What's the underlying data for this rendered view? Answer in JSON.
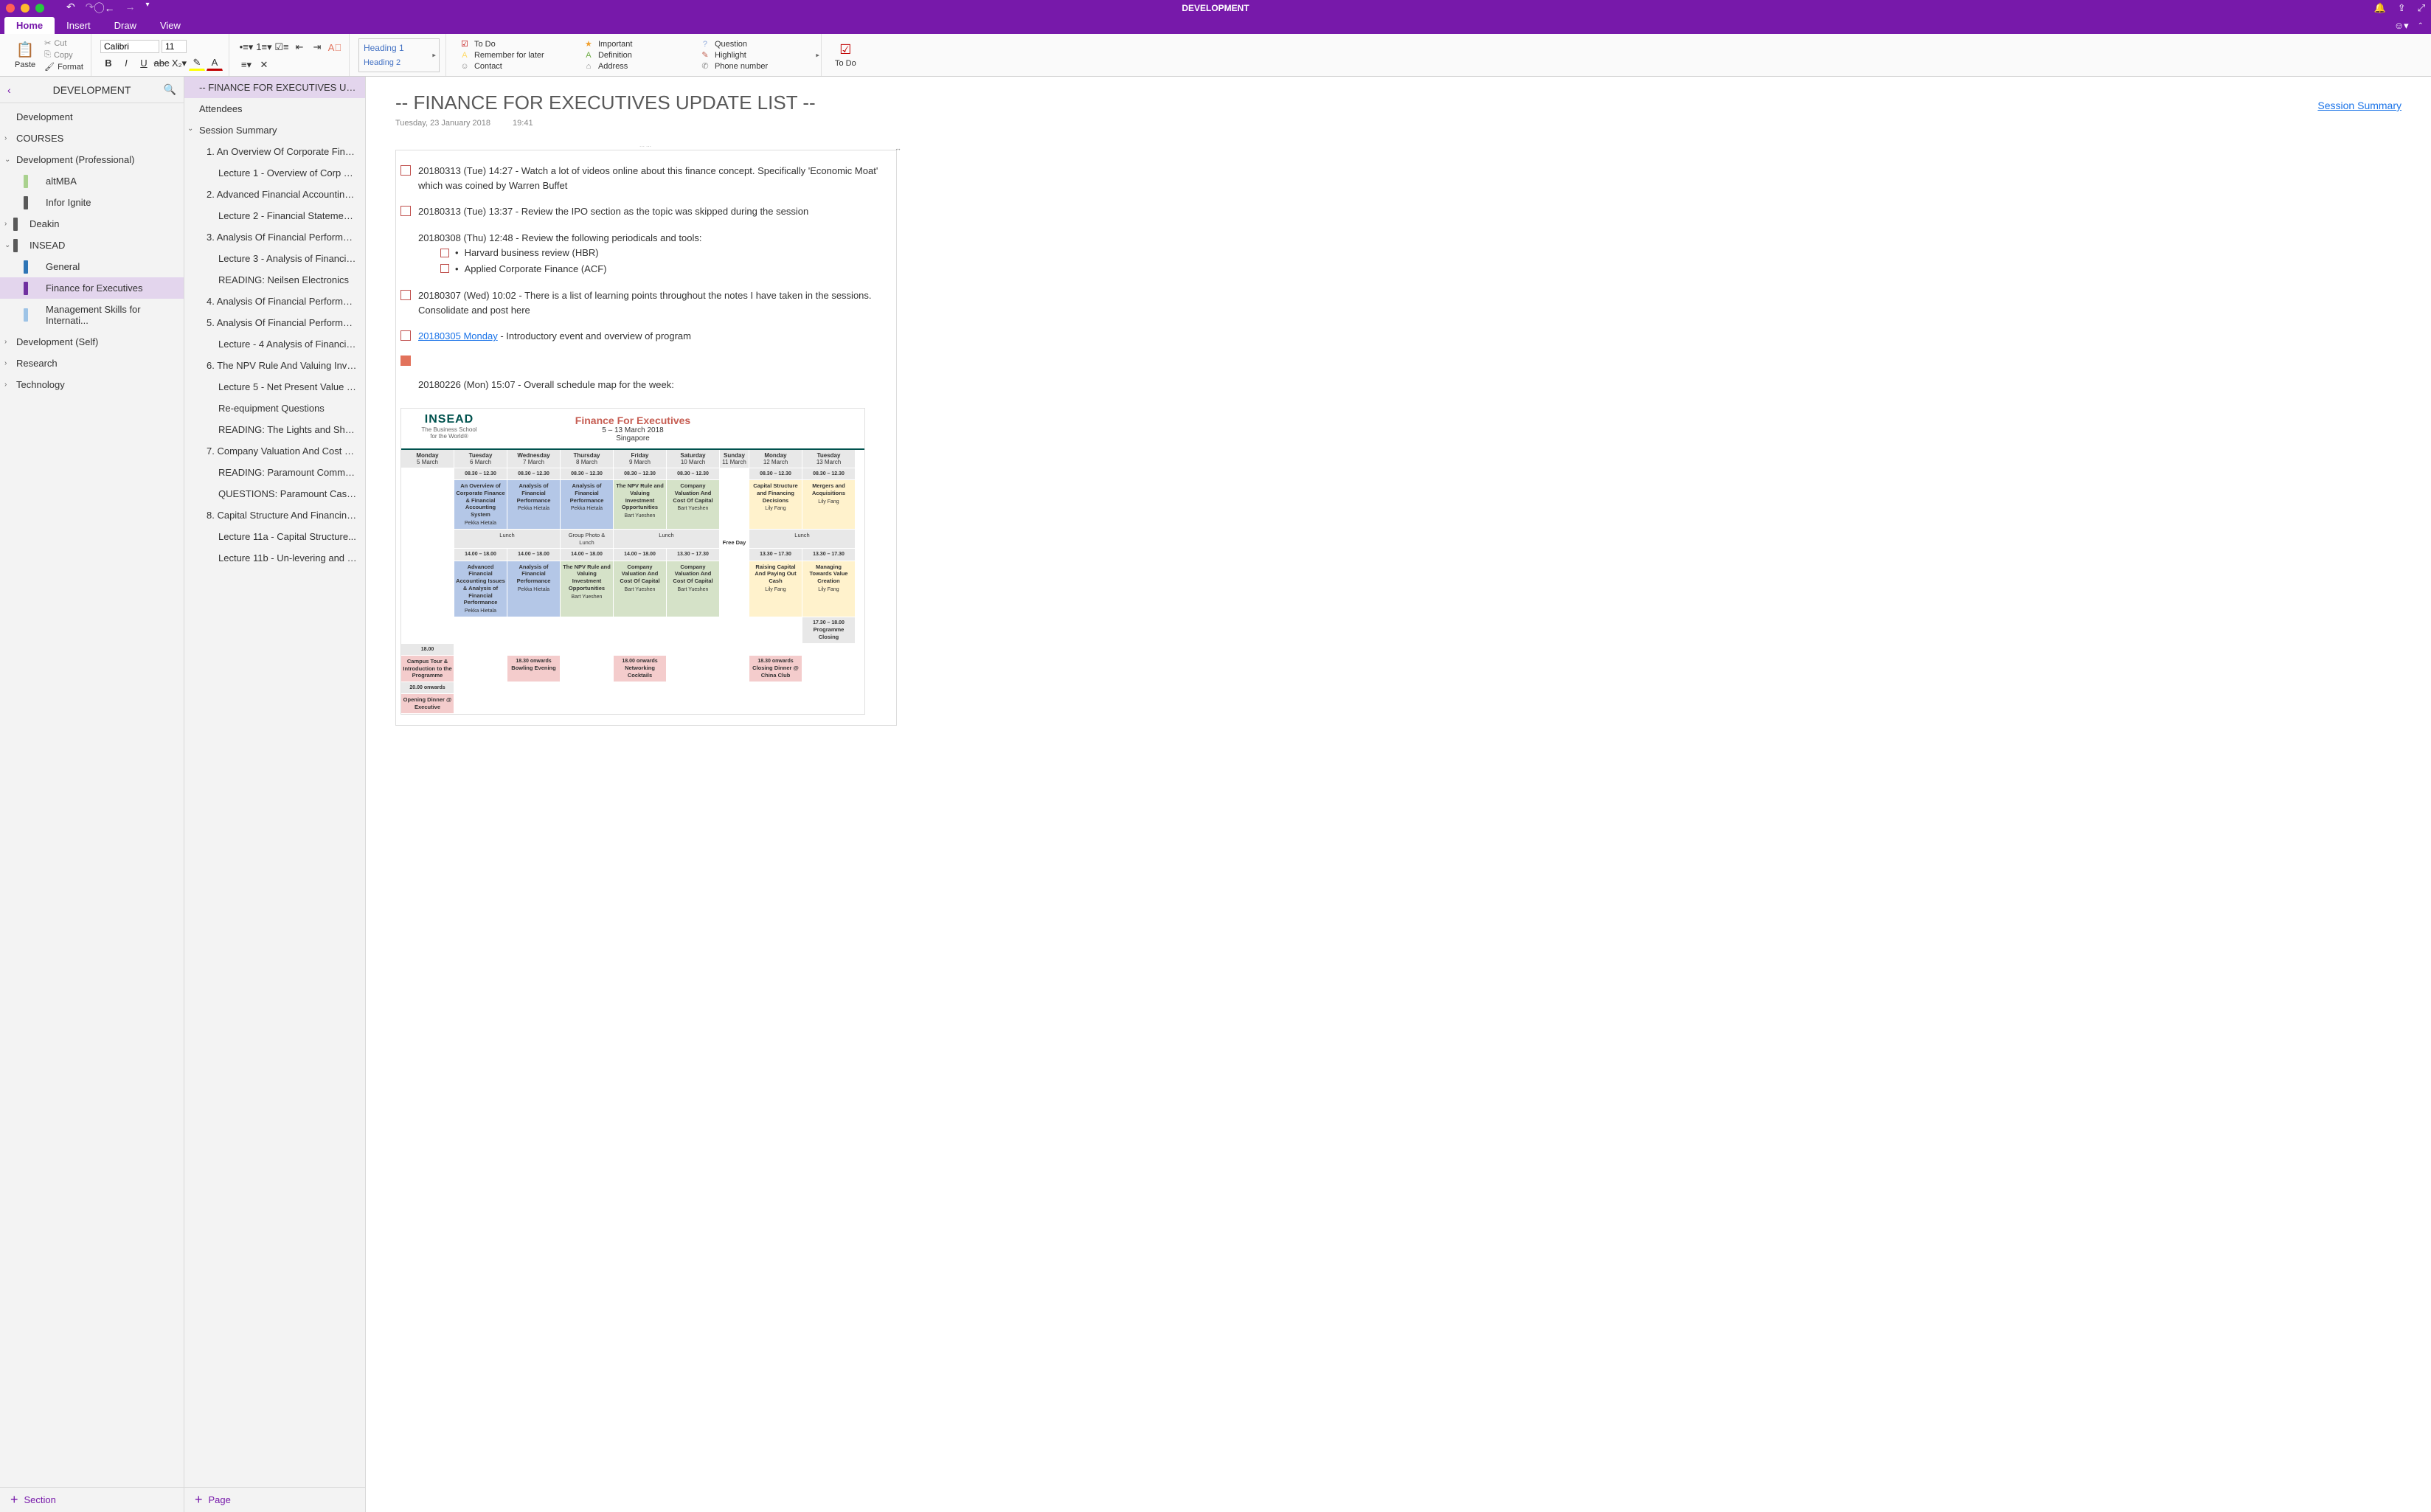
{
  "window": {
    "title": "DEVELOPMENT"
  },
  "tabs": {
    "items": [
      "Home",
      "Insert",
      "Draw",
      "View"
    ],
    "active": 0
  },
  "ribbon": {
    "paste": "Paste",
    "cut": "Cut",
    "copy": "Copy",
    "format": "Format",
    "font_name": "Calibri",
    "font_size": "11",
    "styles": {
      "h1": "Heading 1",
      "h2": "Heading 2"
    },
    "tags": [
      {
        "icon": "☑",
        "color": "#c00000",
        "label": "To Do"
      },
      {
        "icon": "★",
        "color": "#f0a030",
        "label": "Important"
      },
      {
        "icon": "?",
        "color": "#8faadc",
        "label": "Question"
      },
      {
        "icon": "A",
        "color": "#ffd966",
        "label": "Remember for later"
      },
      {
        "icon": "A",
        "color": "#70ad47",
        "label": "Definition"
      },
      {
        "icon": "✎",
        "color": "#c06050",
        "label": "Highlight"
      },
      {
        "icon": "☺",
        "color": "#888",
        "label": "Contact"
      },
      {
        "icon": "⌂",
        "color": "#888",
        "label": "Address"
      },
      {
        "icon": "✆",
        "color": "#888",
        "label": "Phone number"
      }
    ],
    "todo_btn": "To Do"
  },
  "nav": {
    "title": "DEVELOPMENT",
    "items": [
      {
        "label": "Development",
        "level": 0
      },
      {
        "label": "COURSES",
        "level": 0,
        "chev": "›"
      },
      {
        "label": "Development (Professional)",
        "level": 0,
        "chev": "⌄"
      },
      {
        "label": "altMBA",
        "level": 2,
        "color": "#a9d18e"
      },
      {
        "label": "Infor Ignite",
        "level": 2,
        "color": "#595959"
      },
      {
        "label": "Deakin",
        "level": 1,
        "chev": "›",
        "color": "#595959"
      },
      {
        "label": "INSEAD",
        "level": 1,
        "chev": "⌄",
        "color": "#595959"
      },
      {
        "label": "General",
        "level": 2,
        "color": "#2e75b6"
      },
      {
        "label": "Finance for Executives",
        "level": 2,
        "color": "#7030a0",
        "selected": true
      },
      {
        "label": "Management Skills for Internati...",
        "level": 2,
        "color": "#9dc3e6"
      },
      {
        "label": "Development (Self)",
        "level": 0,
        "chev": "›"
      },
      {
        "label": "Research",
        "level": 0,
        "chev": "›"
      },
      {
        "label": "Technology",
        "level": 0,
        "chev": "›"
      }
    ],
    "add_section": "Section"
  },
  "pages": {
    "items": [
      {
        "label": "-- FINANCE FOR EXECUTIVES UPDA...",
        "indent": 0,
        "selected": true
      },
      {
        "label": "Attendees",
        "indent": 0
      },
      {
        "label": "Session Summary",
        "indent": 0,
        "chev": "⌄"
      },
      {
        "label": "1. An Overview Of Corporate Fina...",
        "indent": 1
      },
      {
        "label": "Lecture 1 - Overview of Corp Fi...",
        "indent": 2
      },
      {
        "label": "2. Advanced Financial Accounting...",
        "indent": 1
      },
      {
        "label": "Lecture 2 - Financial Statement...",
        "indent": 2
      },
      {
        "label": "3. Analysis Of Financial Performan...",
        "indent": 1
      },
      {
        "label": "Lecture 3 - Analysis of Financial...",
        "indent": 2
      },
      {
        "label": "READING: Neilsen Electronics",
        "indent": 2
      },
      {
        "label": "4. Analysis Of Financial Performan...",
        "indent": 1
      },
      {
        "label": "5. Analysis Of Financial Performan...",
        "indent": 1
      },
      {
        "label": "Lecture - 4 Analysis of Financia...",
        "indent": 2
      },
      {
        "label": "6. The NPV Rule And Valuing Inve...",
        "indent": 1
      },
      {
        "label": "Lecture 5 - Net Present Value (...",
        "indent": 2
      },
      {
        "label": "Re-equipment Questions",
        "indent": 2
      },
      {
        "label": "READING: The Lights and Shad...",
        "indent": 2
      },
      {
        "label": "7. Company Valuation And Cost Of...",
        "indent": 1
      },
      {
        "label": "READING: Paramount Communi...",
        "indent": 2
      },
      {
        "label": "QUESTIONS: Paramount Case...",
        "indent": 2
      },
      {
        "label": "8. Capital Structure And Financing...",
        "indent": 1
      },
      {
        "label": "Lecture 11a - Capital Structure...",
        "indent": 2
      },
      {
        "label": "Lecture 11b - Un-levering and r...",
        "indent": 2
      }
    ],
    "add_page": "Page"
  },
  "content": {
    "title": "-- FINANCE FOR EXECUTIVES UPDATE LIST --",
    "session_link": "Session Summary",
    "date": "Tuesday, 23 January 2018",
    "time": "19:41",
    "todos": [
      {
        "type": "check",
        "text": "20180313 (Tue) 14:27 - Watch a lot of videos online about this finance concept. Specifically 'Economic Moat' which was coined by Warren Buffet"
      },
      {
        "type": "check",
        "text": "20180313 (Tue) 13:37 - Review the IPO section as the topic was skipped during the session"
      },
      {
        "type": "plain",
        "text": "20180308 (Thu) 12:48 - Review the following periodicals and tools:",
        "bullets": [
          "Harvard business review (HBR)",
          "Applied Corporate Finance (ACF)"
        ]
      },
      {
        "type": "check",
        "text": "20180307 (Wed) 10:02 - There is a list of learning points throughout the notes I have taken in the sessions. Consolidate and post here"
      },
      {
        "type": "check-link",
        "link": "20180305 Monday",
        "text": " - Introductory event and overview of program"
      },
      {
        "type": "orange"
      },
      {
        "type": "plain",
        "text": "20180226 (Mon) 15:07 - Overall schedule map for the week:"
      }
    ]
  },
  "schedule": {
    "logo": "INSEAD",
    "tagline1": "The Business School",
    "tagline2": "for the World®",
    "title": "Finance For Executives",
    "dates": "5 – 13 March 2018",
    "location": "Singapore",
    "days": [
      {
        "name": "Monday",
        "date": "5 March"
      },
      {
        "name": "Tuesday",
        "date": "6 March"
      },
      {
        "name": "Wednesday",
        "date": "7 March"
      },
      {
        "name": "Thursday",
        "date": "8 March"
      },
      {
        "name": "Friday",
        "date": "9 March"
      },
      {
        "name": "Saturday",
        "date": "10 March"
      },
      {
        "name": "Sunday",
        "date": "11 March"
      },
      {
        "name": "Monday",
        "date": "12 March"
      },
      {
        "name": "Tuesday",
        "date": "13 March"
      }
    ],
    "morning_time": "08.30 – 12.30",
    "morning": [
      {
        "title": "An Overview of Corporate Finance & Financial Accounting System",
        "instr": "Pekka Hietala",
        "bg": "bg-blue"
      },
      {
        "title": "Analysis of Financial Performance",
        "instr": "Pekka Hietala",
        "bg": "bg-blue"
      },
      {
        "title": "Analysis of Financial Performance",
        "instr": "Pekka Hietala",
        "bg": "bg-blue"
      },
      {
        "title": "The NPV Rule and Valuing Investment Opportunities",
        "instr": "Bart Yueshen",
        "bg": "bg-green"
      },
      {
        "title": "Company Valuation And Cost Of Capital",
        "instr": "Bart Yueshen",
        "bg": "bg-green"
      },
      {
        "title": "Capital Structure and Financing Decisions",
        "instr": "Lily Fang",
        "bg": "bg-yellow"
      },
      {
        "title": "Mergers and Acquisitions",
        "instr": "Lily Fang",
        "bg": "bg-yellow"
      }
    ],
    "lunch": "Lunch",
    "photo_lunch": "Group Photo & Lunch",
    "free_day": "Free Day",
    "afternoon_time": "14.00 – 18.00",
    "afternoon_time_sat": "13.30 – 17.30",
    "afternoon": [
      {
        "title": "Advanced Financial Accounting Issues & Analysis of Financial Performance",
        "instr": "Pekka Hietala",
        "bg": "bg-blue"
      },
      {
        "title": "Analysis of Financial Performance",
        "instr": "Pekka Hietala",
        "bg": "bg-blue"
      },
      {
        "title": "The NPV Rule and Valuing Investment Opportunities",
        "instr": "Bart Yueshen",
        "bg": "bg-green"
      },
      {
        "title": "Company Valuation And Cost Of Capital",
        "instr": "Bart Yueshen",
        "bg": "bg-green"
      },
      {
        "title": "Company Valuation And Cost Of Capital",
        "instr": "Bart Yueshen",
        "bg": "bg-green"
      },
      {
        "title": "Raising Capital And Paying Out Cash",
        "instr": "Lily Fang",
        "bg": "bg-yellow"
      },
      {
        "title": "Managing Towards Value Creation",
        "instr": "Lily Fang",
        "bg": "bg-yellow"
      }
    ],
    "closing_time": "17.30 – 18.00",
    "closing": "Programme Closing",
    "evening": [
      {
        "time": "18.00",
        "title": "Campus Tour & Introduction to the Programme",
        "bg": "bg-pink"
      },
      {
        "time": "18.30 onwards",
        "title": "Bowling Evening",
        "bg": "bg-pink",
        "col": 3
      },
      {
        "time": "18.00 onwards",
        "title": "Networking Cocktails",
        "bg": "bg-pink",
        "col": 5
      },
      {
        "time": "18.30 onwards",
        "title": "Closing Dinner @ China Club",
        "bg": "bg-pink",
        "col": 8
      }
    ],
    "evening2_time": "20.00 onwards",
    "evening2": "Opening Dinner @ Executive"
  }
}
